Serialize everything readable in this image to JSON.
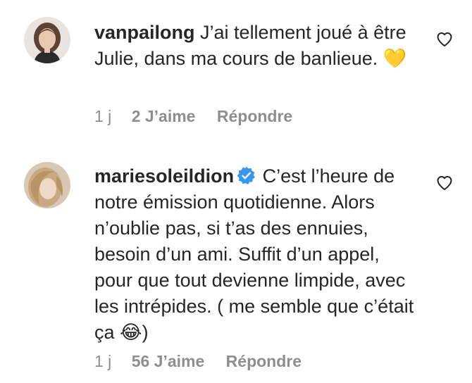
{
  "comments": [
    {
      "username": "vanpailong",
      "verified": false,
      "text": "J’ai tellement joué à être Julie, dans ma cours de banlieue. 💛",
      "time": "1 j",
      "likes": "2 J’aime",
      "reply": "Répondre",
      "avatar_icon": "avatar-woman-dark-hair",
      "like_icon": "heart-outline-icon"
    },
    {
      "username": "mariesoleildion",
      "verified": true,
      "verified_icon": "verified-badge-icon",
      "text": "C’est l’heure de notre émission quotidienne. Alors n’oublie pas, si t’as des ennuies, besoin d’un ami. Suffit d’un appel, pour que tout devienne limpide, avec les intrépides. ( me semble que c’était ça 😂)",
      "time": "1 j",
      "likes": "56 J’aime",
      "reply": "Répondre",
      "avatar_icon": "avatar-woman-blonde-hair",
      "like_icon": "heart-outline-icon"
    }
  ],
  "colors": {
    "text": "#262626",
    "secondary": "#8e8e8e",
    "verified": "#3897f0"
  }
}
